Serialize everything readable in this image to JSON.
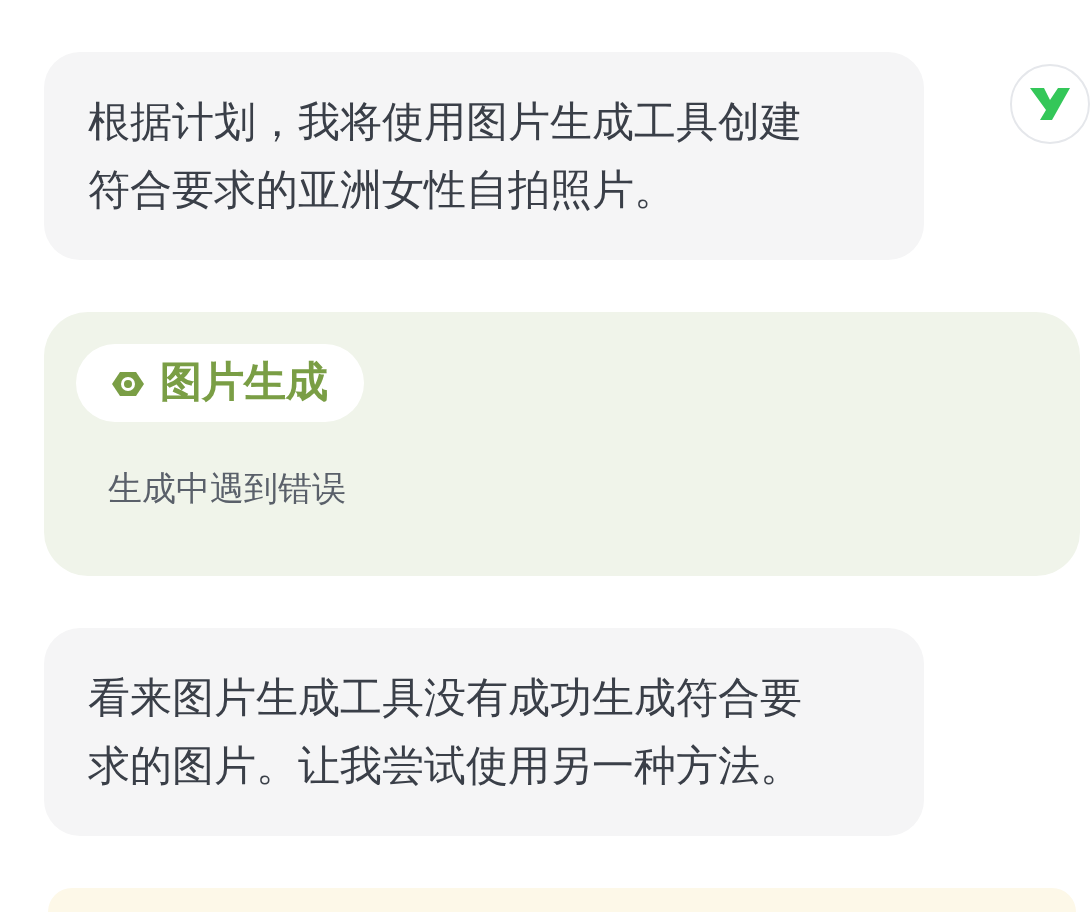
{
  "messages": [
    {
      "kind": "text",
      "text": "根据计划，我将使用图片生成工具创建符合要求的亚洲女性自拍照片。",
      "avatar": true
    },
    {
      "kind": "tool",
      "title": "图片生成",
      "status": "生成中遇到错误"
    },
    {
      "kind": "text",
      "text": "看来图片生成工具没有成功生成符合要求的图片。让我尝试使用另一种方法。",
      "avatar": false
    }
  ]
}
